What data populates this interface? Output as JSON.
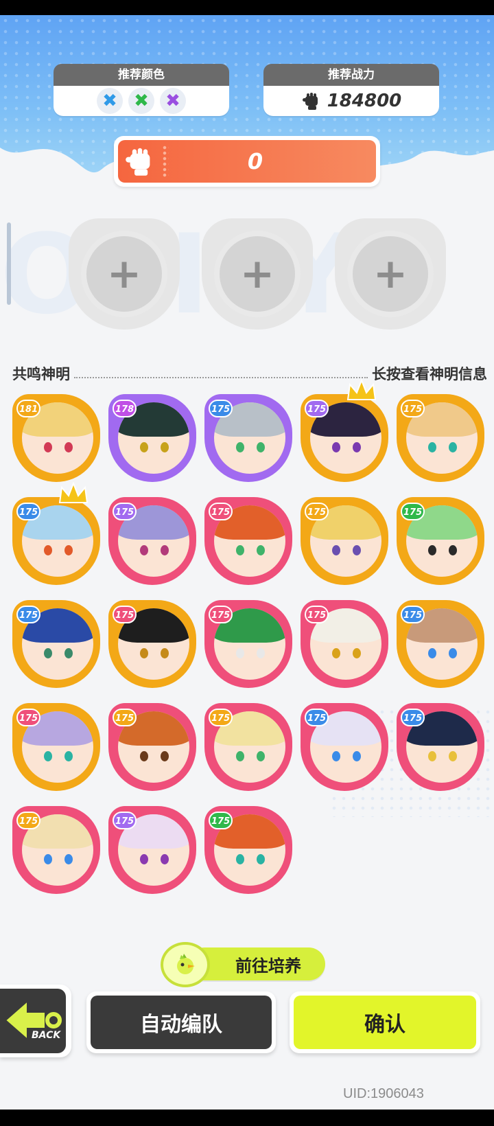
{
  "recommend_color": {
    "label": "推荐颜色",
    "colors": [
      {
        "name": "blue",
        "hex": "#2f9ae8",
        "glyph": "✖"
      },
      {
        "name": "green",
        "hex": "#2fb84a",
        "glyph": "✖"
      },
      {
        "name": "purple",
        "hex": "#9a4fe0",
        "glyph": "✖"
      }
    ]
  },
  "recommend_power": {
    "label": "推荐战力",
    "value": "184800",
    "icon": "fist-icon"
  },
  "team_power": {
    "value": "0",
    "icon": "fist-icon"
  },
  "slots": [
    {
      "name": "empty-slot",
      "glyph": "+"
    },
    {
      "name": "empty-slot",
      "glyph": "+"
    },
    {
      "name": "empty-slot",
      "glyph": "+"
    }
  ],
  "section": {
    "title": "共鸣神明",
    "hint": "长按查看神明信息"
  },
  "characters": [
    {
      "level": "181",
      "frame": "#f3a817",
      "badge": "#f3a817",
      "hair": "#f2d27a",
      "eye": "#d23a55",
      "crown": false
    },
    {
      "level": "178",
      "frame": "#a16af0",
      "badge": "#c04fe6",
      "hair": "#233a36",
      "eye": "#c7a21a",
      "crown": false
    },
    {
      "level": "175",
      "frame": "#a16af0",
      "badge": "#3a8be8",
      "hair": "#b8c0c8",
      "eye": "#3fb36a",
      "crown": false
    },
    {
      "level": "175",
      "frame": "#f3a817",
      "badge": "#a16af0",
      "hair": "#2c2440",
      "eye": "#7a3ab0",
      "crown": true
    },
    {
      "level": "175",
      "frame": "#f3a817",
      "badge": "#f3a817",
      "hair": "#f0c98a",
      "eye": "#2ab3a3",
      "crown": false
    },
    {
      "level": "175",
      "frame": "#f3a817",
      "badge": "#3a8be8",
      "hair": "#a9d4ee",
      "eye": "#e25a2a",
      "crown": true
    },
    {
      "level": "175",
      "frame": "#ef4f7a",
      "badge": "#a16af0",
      "hair": "#9d96d8",
      "eye": "#b23a7a",
      "crown": false
    },
    {
      "level": "175",
      "frame": "#ef4f7a",
      "badge": "#ef4f7a",
      "hair": "#e2602a",
      "eye": "#3fb36a",
      "crown": false
    },
    {
      "level": "175",
      "frame": "#f3a817",
      "badge": "#f3a817",
      "hair": "#f0d16a",
      "eye": "#6a4fb0",
      "crown": false
    },
    {
      "level": "175",
      "frame": "#f3a817",
      "badge": "#2fb84a",
      "hair": "#8fd88a",
      "eye": "#2a2a2a",
      "crown": false
    },
    {
      "level": "175",
      "frame": "#f3a817",
      "badge": "#3a8be8",
      "hair": "#2a4aa6",
      "eye": "#3a8a6a",
      "crown": false
    },
    {
      "level": "175",
      "frame": "#f3a817",
      "badge": "#ef4f7a",
      "hair": "#1e1e1e",
      "eye": "#c58a1a",
      "crown": false
    },
    {
      "level": "175",
      "frame": "#ef4f7a",
      "badge": "#ef4f7a",
      "hair": "#2f9a4a",
      "eye": "#e8e8e8",
      "crown": false
    },
    {
      "level": "175",
      "frame": "#ef4f7a",
      "badge": "#ef4f7a",
      "hair": "#f2efe6",
      "eye": "#d9a21a",
      "crown": false
    },
    {
      "level": "175",
      "frame": "#f3a817",
      "badge": "#3a8be8",
      "hair": "#c89a7a",
      "eye": "#3a8be8",
      "crown": false
    },
    {
      "level": "175",
      "frame": "#f3a817",
      "badge": "#ef4f7a",
      "hair": "#b7a7e0",
      "eye": "#2ab3a3",
      "crown": false
    },
    {
      "level": "175",
      "frame": "#ef4f7a",
      "badge": "#f3a817",
      "hair": "#d46a2a",
      "eye": "#6a3a1a",
      "crown": false
    },
    {
      "level": "175",
      "frame": "#ef4f7a",
      "badge": "#f3a817",
      "hair": "#f2e2a0",
      "eye": "#3fb36a",
      "crown": false
    },
    {
      "level": "175",
      "frame": "#ef4f7a",
      "badge": "#3a8be8",
      "hair": "#e6e2f4",
      "eye": "#3a8be8",
      "crown": false
    },
    {
      "level": "175",
      "frame": "#ef4f7a",
      "badge": "#3a8be8",
      "hair": "#1e2a4a",
      "eye": "#e8c03a",
      "crown": false
    },
    {
      "level": "175",
      "frame": "#ef4f7a",
      "badge": "#f3a817",
      "hair": "#f2dfb0",
      "eye": "#3a8be8",
      "crown": false
    },
    {
      "level": "175",
      "frame": "#ef4f7a",
      "badge": "#a16af0",
      "hair": "#ecdcf2",
      "eye": "#8a3ab0",
      "crown": false
    },
    {
      "level": "175",
      "frame": "#ef4f7a",
      "badge": "#2fb84a",
      "hair": "#e2602a",
      "eye": "#2ab3a3",
      "crown": false
    }
  ],
  "cultivate_button": {
    "label": "前往培养",
    "icon": "bird-icon"
  },
  "back_button": {
    "label": "BACK",
    "icon": "arrow-left-icon"
  },
  "auto_team_button": {
    "label": "自动编队"
  },
  "confirm_button": {
    "label": "确认"
  },
  "uid": "UID:1906043"
}
